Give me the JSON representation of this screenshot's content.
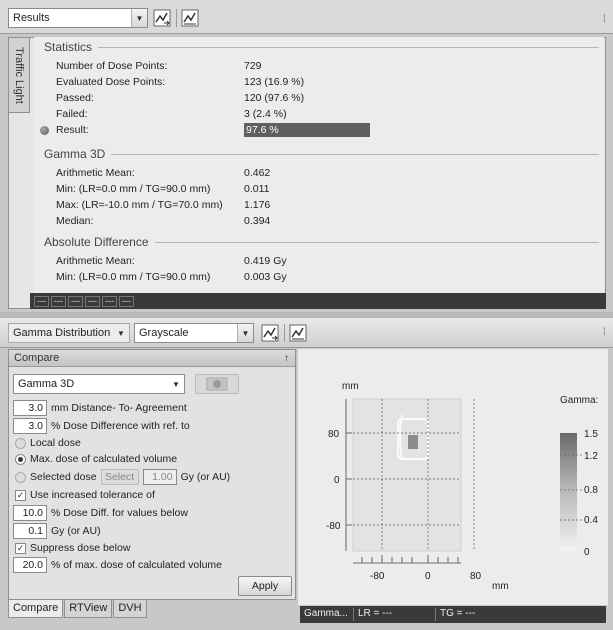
{
  "top_toolbar": {
    "view_select": "Results"
  },
  "side_tab": "Traffic Light",
  "statistics": {
    "title": "Statistics",
    "rows": [
      {
        "label": "Number of Dose Points:",
        "value": "729"
      },
      {
        "label": "Evaluated Dose Points:",
        "value": "123 (16.9 %)"
      },
      {
        "label": "Passed:",
        "value": "120 (97.6 %)"
      },
      {
        "label": "Failed:",
        "value": "3 (2.4 %)"
      },
      {
        "label": "Result:",
        "value": "97.6 %"
      }
    ]
  },
  "gamma3d": {
    "title": "Gamma 3D",
    "rows": [
      {
        "label": "Arithmetic Mean:",
        "value": "0.462"
      },
      {
        "label": "Min: (LR=0.0 mm / TG=90.0 mm)",
        "value": "0.011"
      },
      {
        "label": "Max: (LR=-10.0 mm / TG=70.0 mm)",
        "value": "1.176"
      },
      {
        "label": "Median:",
        "value": "0.394"
      }
    ]
  },
  "absdiff": {
    "title": "Absolute Difference",
    "rows": [
      {
        "label": "Arithmetic Mean:",
        "value": "0.419 Gy"
      },
      {
        "label": "Min: (LR=0.0 mm / TG=90.0 mm)",
        "value": "0.003 Gy"
      }
    ]
  },
  "status_cells": [
    "---",
    "---",
    "---",
    "---",
    "---",
    "---"
  ],
  "lower_toolbar": {
    "distribution_select": "Gamma Distribution",
    "color_select": "Grayscale"
  },
  "compare": {
    "title": "Compare",
    "pin": "↑",
    "method_select": "Gamma 3D",
    "dta_value": "3.0",
    "dta_label": "mm Distance- To- Agreement",
    "dd_value": "3.0",
    "dd_label": "% Dose Difference with ref. to",
    "local_dose": "Local dose",
    "max_dose": "Max. dose of calculated volume",
    "selected_dose": "Selected dose",
    "select_button": "Select",
    "selected_value": "1.00",
    "selected_unit": "Gy (or AU)",
    "increased_tol": "Use increased tolerance of",
    "tol_value": "10.0",
    "tol_label": "% Dose Diff. for values below",
    "below_value": "0.1",
    "below_label": "Gy (or AU)",
    "suppress": "Suppress dose below",
    "suppress_value": "20.0",
    "suppress_label": "% of max. dose of calculated volume",
    "apply": "Apply"
  },
  "bottom_tabs": [
    "Compare",
    "RTView",
    "DVH"
  ],
  "plot": {
    "unit_top": "mm",
    "unit_bottom": "mm",
    "y_ticks": [
      "80",
      "0",
      "-80"
    ],
    "x_ticks": [
      "-80",
      "0",
      "80"
    ],
    "scale_title": "Gamma:",
    "scale_ticks": [
      "1.5",
      "1.2",
      "0.8",
      "0.4",
      "0"
    ]
  },
  "plot_status": {
    "map": "Gamma...",
    "lr": "LR = ---",
    "tg": "TG = ---"
  }
}
